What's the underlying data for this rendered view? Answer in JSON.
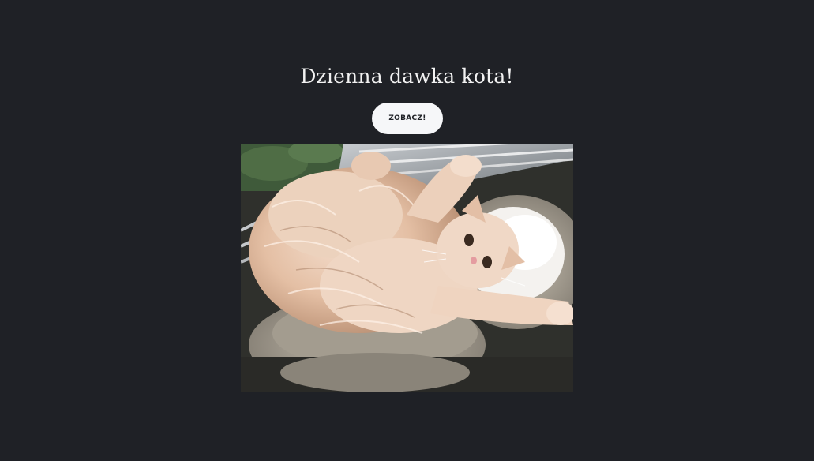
{
  "header": {
    "title": "Dzienna dawka kota!"
  },
  "action": {
    "button_label": "ZOBACZ!"
  },
  "colors": {
    "background": "#1f2126",
    "title_text": "#f2f2f2",
    "button_bg": "#f6f7f9",
    "button_text": "#1f2126"
  }
}
